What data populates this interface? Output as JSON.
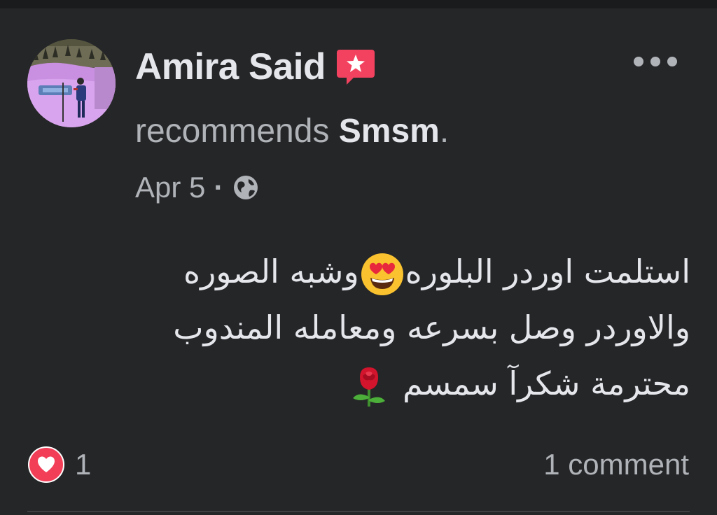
{
  "post": {
    "author": "Amira Said",
    "action": "recommends",
    "page": "Smsm",
    "period": ".",
    "date": "Apr 5",
    "separator": "·",
    "badge_icon": "recommendation-star-icon",
    "privacy_icon": "globe-icon",
    "more_icon": "more-horizontal-icon",
    "body_lines": [
      "استلمت اوردر البلوره",
      "وشبه الصوره",
      "والاوردر وصل بسرعه ومعامله المندوب",
      "محترمة شكرآ سمسم"
    ],
    "body_emojis": [
      "heart-eyes-emoji",
      "rose-emoji"
    ]
  },
  "footer": {
    "reaction_icon": "love-reaction-icon",
    "reaction_count": "1",
    "comments": "1 comment"
  },
  "colors": {
    "background": "#252628",
    "primary_text": "#e4e6eb",
    "secondary_text": "#b0b3b8",
    "love_red": "#f33e58",
    "badge_pink": "#f3425f"
  }
}
